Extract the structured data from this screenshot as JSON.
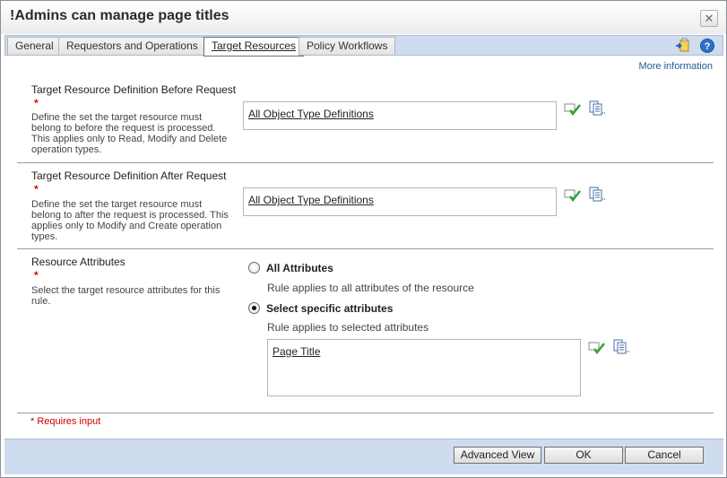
{
  "window": {
    "title": "!Admins can manage page titles",
    "close_glyph": "✕"
  },
  "tabs": [
    {
      "label": "General",
      "active": false
    },
    {
      "label": "Requestors and Operations",
      "active": false
    },
    {
      "label": "Target Resources",
      "active": true
    },
    {
      "label": "Policy Workflows",
      "active": false
    }
  ],
  "toolbar_icons": [
    "export-icon",
    "help-icon"
  ],
  "more_information": "More information",
  "sections": {
    "before": {
      "label": "Target Resource Definition Before Request",
      "required_mark": "*",
      "description": "Define the set the target resource must belong to before the request is processed. This applies only to Read, Modify and Delete operation types.",
      "value": "All Object Type Definitions"
    },
    "after": {
      "label": "Target Resource Definition After Request",
      "required_mark": "*",
      "description": "Define the set the target resource must belong to after the request is processed. This applies only to Modify and Create operation types.",
      "value": "All Object Type Definitions"
    },
    "attributes": {
      "label": "Resource Attributes",
      "required_mark": "*",
      "description": "Select the target resource attributes for this rule.",
      "options": [
        {
          "label": "All Attributes",
          "note": "Rule applies to all attributes of the resource",
          "checked": false
        },
        {
          "label": "Select specific attributes",
          "note": "Rule applies to selected attributes",
          "checked": true
        }
      ],
      "selected_value": "Page Title"
    }
  },
  "requires_input": "* Requires input",
  "buttons": {
    "advanced": "Advanced View",
    "ok": "OK",
    "cancel": "Cancel"
  },
  "colors": {
    "accent": "#235a99",
    "required": "#cc0000",
    "tabbar": "#cfdcef",
    "check": "#2fa12f"
  }
}
